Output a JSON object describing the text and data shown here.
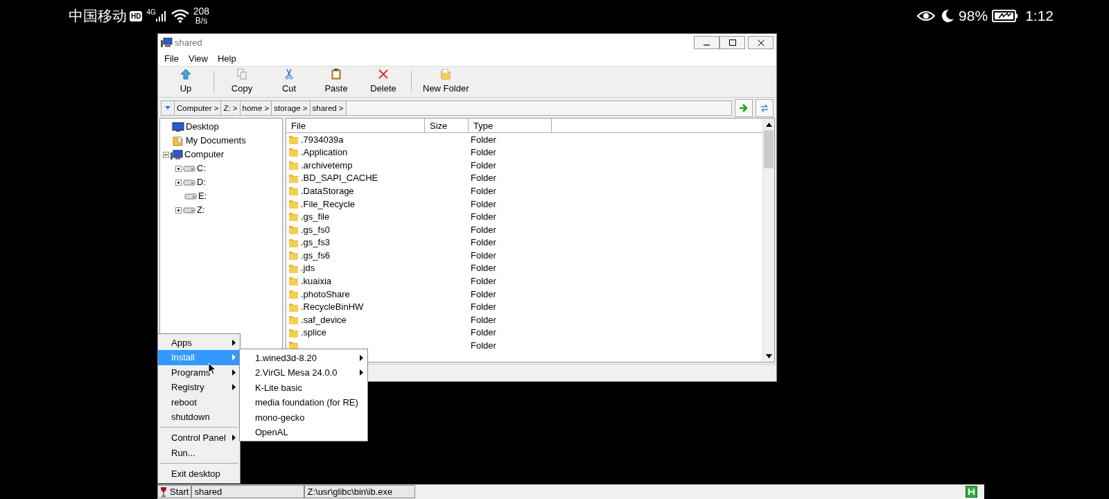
{
  "phone_status": {
    "carrier": "中国移动",
    "hd": "HD",
    "network": "4G",
    "speed": "208",
    "speed_unit": "B/s",
    "battery": "98%",
    "time": "1:12"
  },
  "window": {
    "title": "shared"
  },
  "menu": [
    "File",
    "View",
    "Help"
  ],
  "toolbar": [
    {
      "label": "Up"
    },
    {
      "label": "Copy"
    },
    {
      "label": "Cut"
    },
    {
      "label": "Paste"
    },
    {
      "label": "Delete"
    },
    {
      "label": "New Folder"
    }
  ],
  "address": [
    "Computer >",
    "Z: >",
    "home >",
    "storage >",
    "shared >"
  ],
  "tree": [
    {
      "label": "Desktop"
    },
    {
      "label": "My Documents"
    },
    {
      "label": "Computer",
      "expanded": true,
      "children": [
        {
          "label": "C:",
          "expanded": false
        },
        {
          "label": "D:",
          "expanded": false
        },
        {
          "label": "E:"
        },
        {
          "label": "Z:",
          "expanded": false
        }
      ]
    }
  ],
  "columns": [
    "File",
    "Size",
    "Type"
  ],
  "files": [
    {
      "name": ".7934039a",
      "type": "Folder"
    },
    {
      "name": ".Application",
      "type": "Folder"
    },
    {
      "name": ".archivetemp",
      "type": "Folder"
    },
    {
      "name": ".BD_SAPI_CACHE",
      "type": "Folder"
    },
    {
      "name": ".DataStorage",
      "type": "Folder"
    },
    {
      "name": ".File_Recycle",
      "type": "Folder"
    },
    {
      "name": ".gs_file",
      "type": "Folder"
    },
    {
      "name": ".gs_fs0",
      "type": "Folder"
    },
    {
      "name": ".gs_fs3",
      "type": "Folder"
    },
    {
      "name": ".gs_fs6",
      "type": "Folder"
    },
    {
      "name": ".jds",
      "type": "Folder"
    },
    {
      "name": ".kuaixia",
      "type": "Folder"
    },
    {
      "name": ".photoShare",
      "type": "Folder"
    },
    {
      "name": ".RecycleBinHW",
      "type": "Folder"
    },
    {
      "name": ".saf_device",
      "type": "Folder"
    },
    {
      "name": ".splice",
      "type": "Folder"
    },
    {
      "type": "Folder"
    }
  ],
  "start_menu": [
    {
      "kind": "item",
      "label": "Apps",
      "submenu": true,
      "selected": false
    },
    {
      "kind": "item",
      "label": "Install",
      "submenu": true,
      "selected": true
    },
    {
      "kind": "item",
      "label": "Programs",
      "submenu": true,
      "selected": false
    },
    {
      "kind": "item",
      "label": "Registry",
      "submenu": true,
      "selected": false
    },
    {
      "kind": "item",
      "label": "reboot",
      "submenu": false,
      "selected": false
    },
    {
      "kind": "item",
      "label": "shutdown",
      "submenu": false,
      "selected": false
    },
    {
      "kind": "separator"
    },
    {
      "kind": "item",
      "label": "Control Panel",
      "submenu": true,
      "selected": false
    },
    {
      "kind": "item",
      "label": "Run...",
      "submenu": false,
      "selected": false
    },
    {
      "kind": "separator"
    },
    {
      "kind": "item",
      "label": "Exit desktop",
      "submenu": false,
      "selected": false
    }
  ],
  "install_menu": [
    {
      "label": "1.wined3d-8.20",
      "submenu": true
    },
    {
      "label": "2.VirGL Mesa 24.0.0",
      "submenu": true
    },
    {
      "label": "K-Lite basic",
      "submenu": false
    },
    {
      "label": "media foundation (for RE)",
      "submenu": false
    },
    {
      "label": "mono-gecko",
      "submenu": false
    },
    {
      "label": "OpenAL",
      "submenu": false
    }
  ],
  "taskbar": {
    "start": "Start",
    "tasks": [
      "shared",
      "Z:\\usr\\glibc\\bin\\ib.exe"
    ]
  }
}
